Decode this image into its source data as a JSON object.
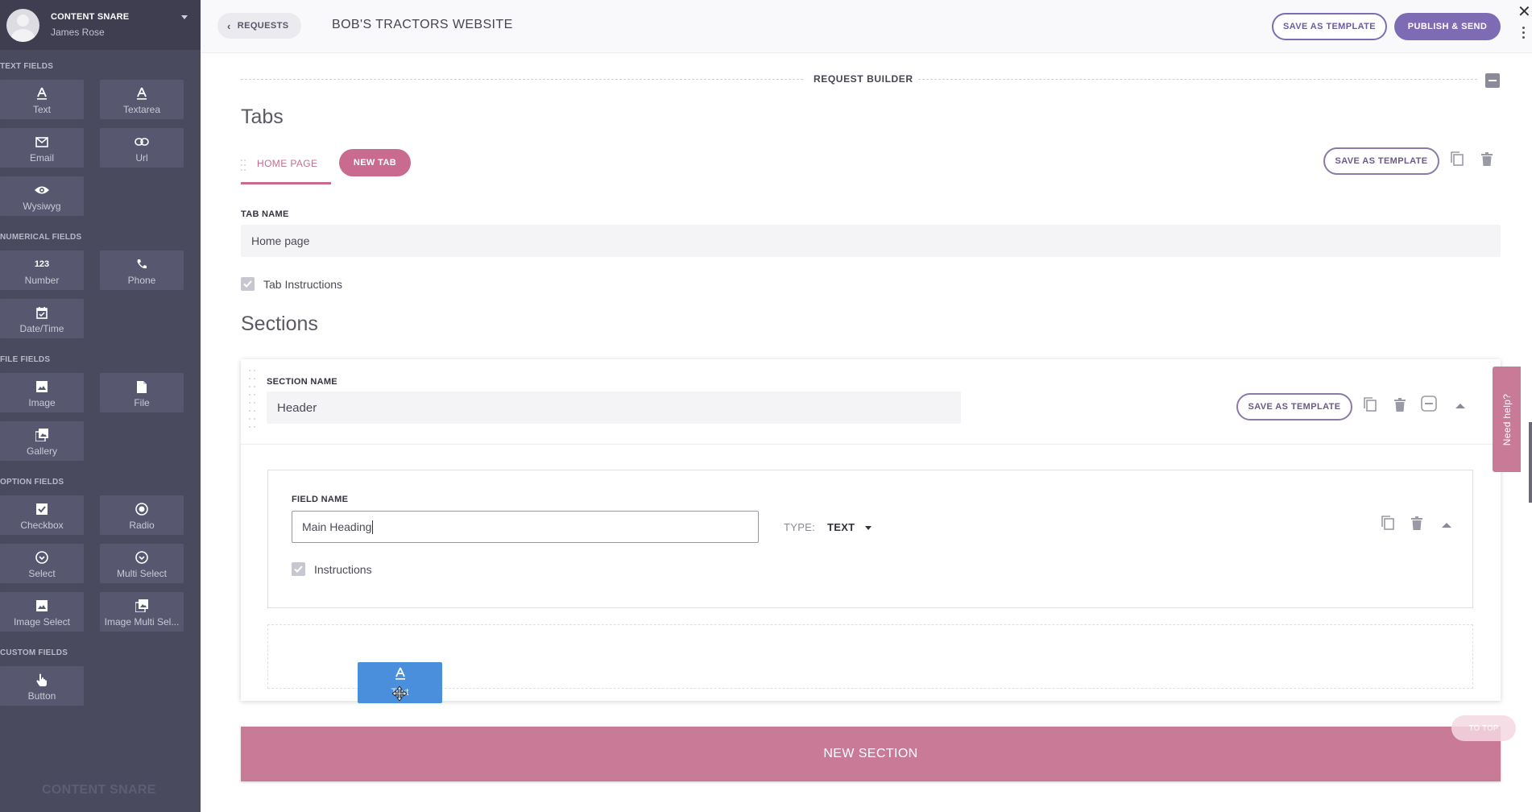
{
  "sidebar": {
    "app_name": "CONTENT SNARE",
    "user_name": "James Rose",
    "groups": {
      "text": "TEXT FIELDS",
      "numerical": "NUMERICAL FIELDS",
      "file": "FILE FIELDS",
      "option": "OPTION FIELDS",
      "custom": "CUSTOM FIELDS"
    },
    "tiles": {
      "text": "Text",
      "textarea": "Textarea",
      "email": "Email",
      "url": "Url",
      "wysiwyg": "Wysiwyg",
      "number": "Number",
      "phone": "Phone",
      "datetime": "Date/Time",
      "image": "Image",
      "file": "File",
      "gallery": "Gallery",
      "checkbox": "Checkbox",
      "radio": "Radio",
      "select": "Select",
      "multi_select": "Multi Select",
      "image_select": "Image Select",
      "image_multi_select": "Image Multi Sel...",
      "button": "Button"
    },
    "footer": "CONTENT SNARE",
    "number_icon_text": "123"
  },
  "header": {
    "back_label": "REQUESTS",
    "title": "BOB'S TRACTORS WEBSITE",
    "save_template_label": "SAVE AS TEMPLATE",
    "publish_label": "PUBLISH & SEND"
  },
  "builder": {
    "title": "REQUEST BUILDER",
    "tabs_heading": "Tabs",
    "tabs": [
      {
        "label": "HOME PAGE"
      }
    ],
    "new_tab_label": "NEW TAB",
    "tab_save_template_label": "SAVE AS TEMPLATE",
    "tab_name_label": "TAB NAME",
    "tab_name_value": "Home page",
    "tab_instructions_label": "Tab Instructions",
    "sections_heading": "Sections",
    "section": {
      "name_label": "SECTION NAME",
      "name_value": "Header",
      "save_template_label": "SAVE AS TEMPLATE",
      "field": {
        "name_label": "FIELD NAME",
        "name_value": "Main Heading",
        "type_label": "TYPE:",
        "type_value": "TEXT",
        "instructions_label": "Instructions"
      }
    },
    "drag_chip_label": "Text",
    "new_section_label": "NEW SECTION",
    "to_top_label": "TO TOP"
  },
  "help": {
    "label": "Need help?"
  },
  "colors": {
    "sidebar_bg": "#4a4a5e",
    "accent_purple": "#7d6cb4",
    "accent_pink": "#c86b8e",
    "drag_blue": "#4a8fdb"
  }
}
